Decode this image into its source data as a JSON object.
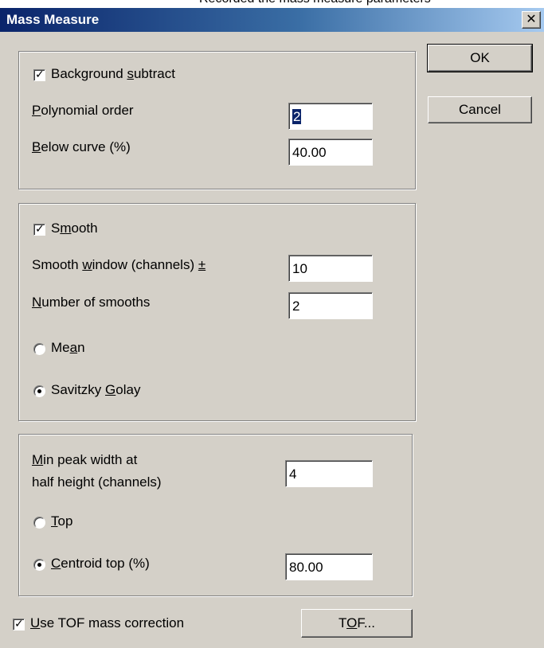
{
  "window": {
    "title": "Mass Measure",
    "clipped_text": "Recorded the mass measure parameters"
  },
  "buttons": {
    "ok": "OK",
    "cancel": "Cancel",
    "tof": "TOF..."
  },
  "background": {
    "checkbox_label": "Background subtract",
    "checked": true,
    "polynomial_order_label": "Polynomial order",
    "polynomial_order_value": "2",
    "below_curve_label": "Below curve (%)",
    "below_curve_value": "40.00"
  },
  "smooth": {
    "checkbox_label": "Smooth",
    "checked": true,
    "window_label": "Smooth window (channels) ±",
    "window_value": "10",
    "number_label": "Number of smooths",
    "number_value": "2",
    "mean_label": "Mean",
    "savitzky_label": "Savitzky Golay",
    "selected_method": "Savitzky Golay"
  },
  "peak": {
    "min_width_label_line1": "Min peak width at",
    "min_width_label_line2": "half height (channels)",
    "min_width_value": "4",
    "top_label": "Top",
    "centroid_label": "Centroid top (%)",
    "centroid_value": "80.00",
    "selected_mode": "Centroid top (%)"
  },
  "tof": {
    "checkbox_label": "Use TOF mass correction",
    "checked": true
  }
}
